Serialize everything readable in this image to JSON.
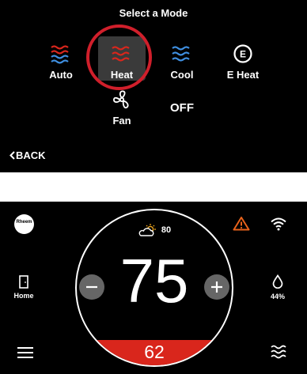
{
  "mode_select": {
    "title": "Select a Mode",
    "modes": [
      {
        "id": "auto",
        "label": "Auto",
        "icon": "auto-waves-icon"
      },
      {
        "id": "heat",
        "label": "Heat",
        "icon": "heat-waves-icon",
        "selected": true
      },
      {
        "id": "cool",
        "label": "Cool",
        "icon": "cool-waves-icon"
      },
      {
        "id": "eheat",
        "label": "E Heat",
        "icon": "emergency-heat-icon",
        "icon_glyph": "E"
      },
      {
        "id": "fan",
        "label": "Fan",
        "icon": "fan-icon"
      }
    ],
    "off_label": "OFF",
    "back_label": "BACK"
  },
  "thermostat": {
    "brand": "Rheem",
    "outdoor_temp": "80",
    "setpoint": "75",
    "current_temp": "62",
    "home_label": "Home",
    "humidity": "44%"
  },
  "colors": {
    "heat": "#d9261c",
    "cool": "#3f8fe0",
    "alert": "#e8621b",
    "selection_ring": "#d01f2b",
    "background": "#000000"
  }
}
